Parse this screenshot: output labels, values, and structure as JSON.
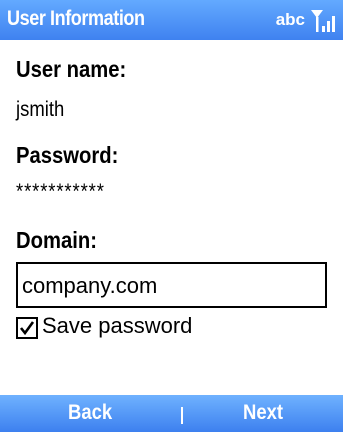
{
  "titlebar": {
    "title": "User Information",
    "input_mode": "abc",
    "signal_icon": "signal-strength-icon"
  },
  "form": {
    "username_label": "User name:",
    "username_value": "jsmith",
    "password_label": "Password:",
    "password_value": "***********",
    "domain_label": "Domain:",
    "domain_value": "company.com",
    "save_password_label": "Save password",
    "save_password_checked": true
  },
  "softkeys": {
    "left": "Back",
    "right": "Next"
  },
  "colors": {
    "bar_top": "#63aaff",
    "bar_bottom": "#3f82f0"
  }
}
